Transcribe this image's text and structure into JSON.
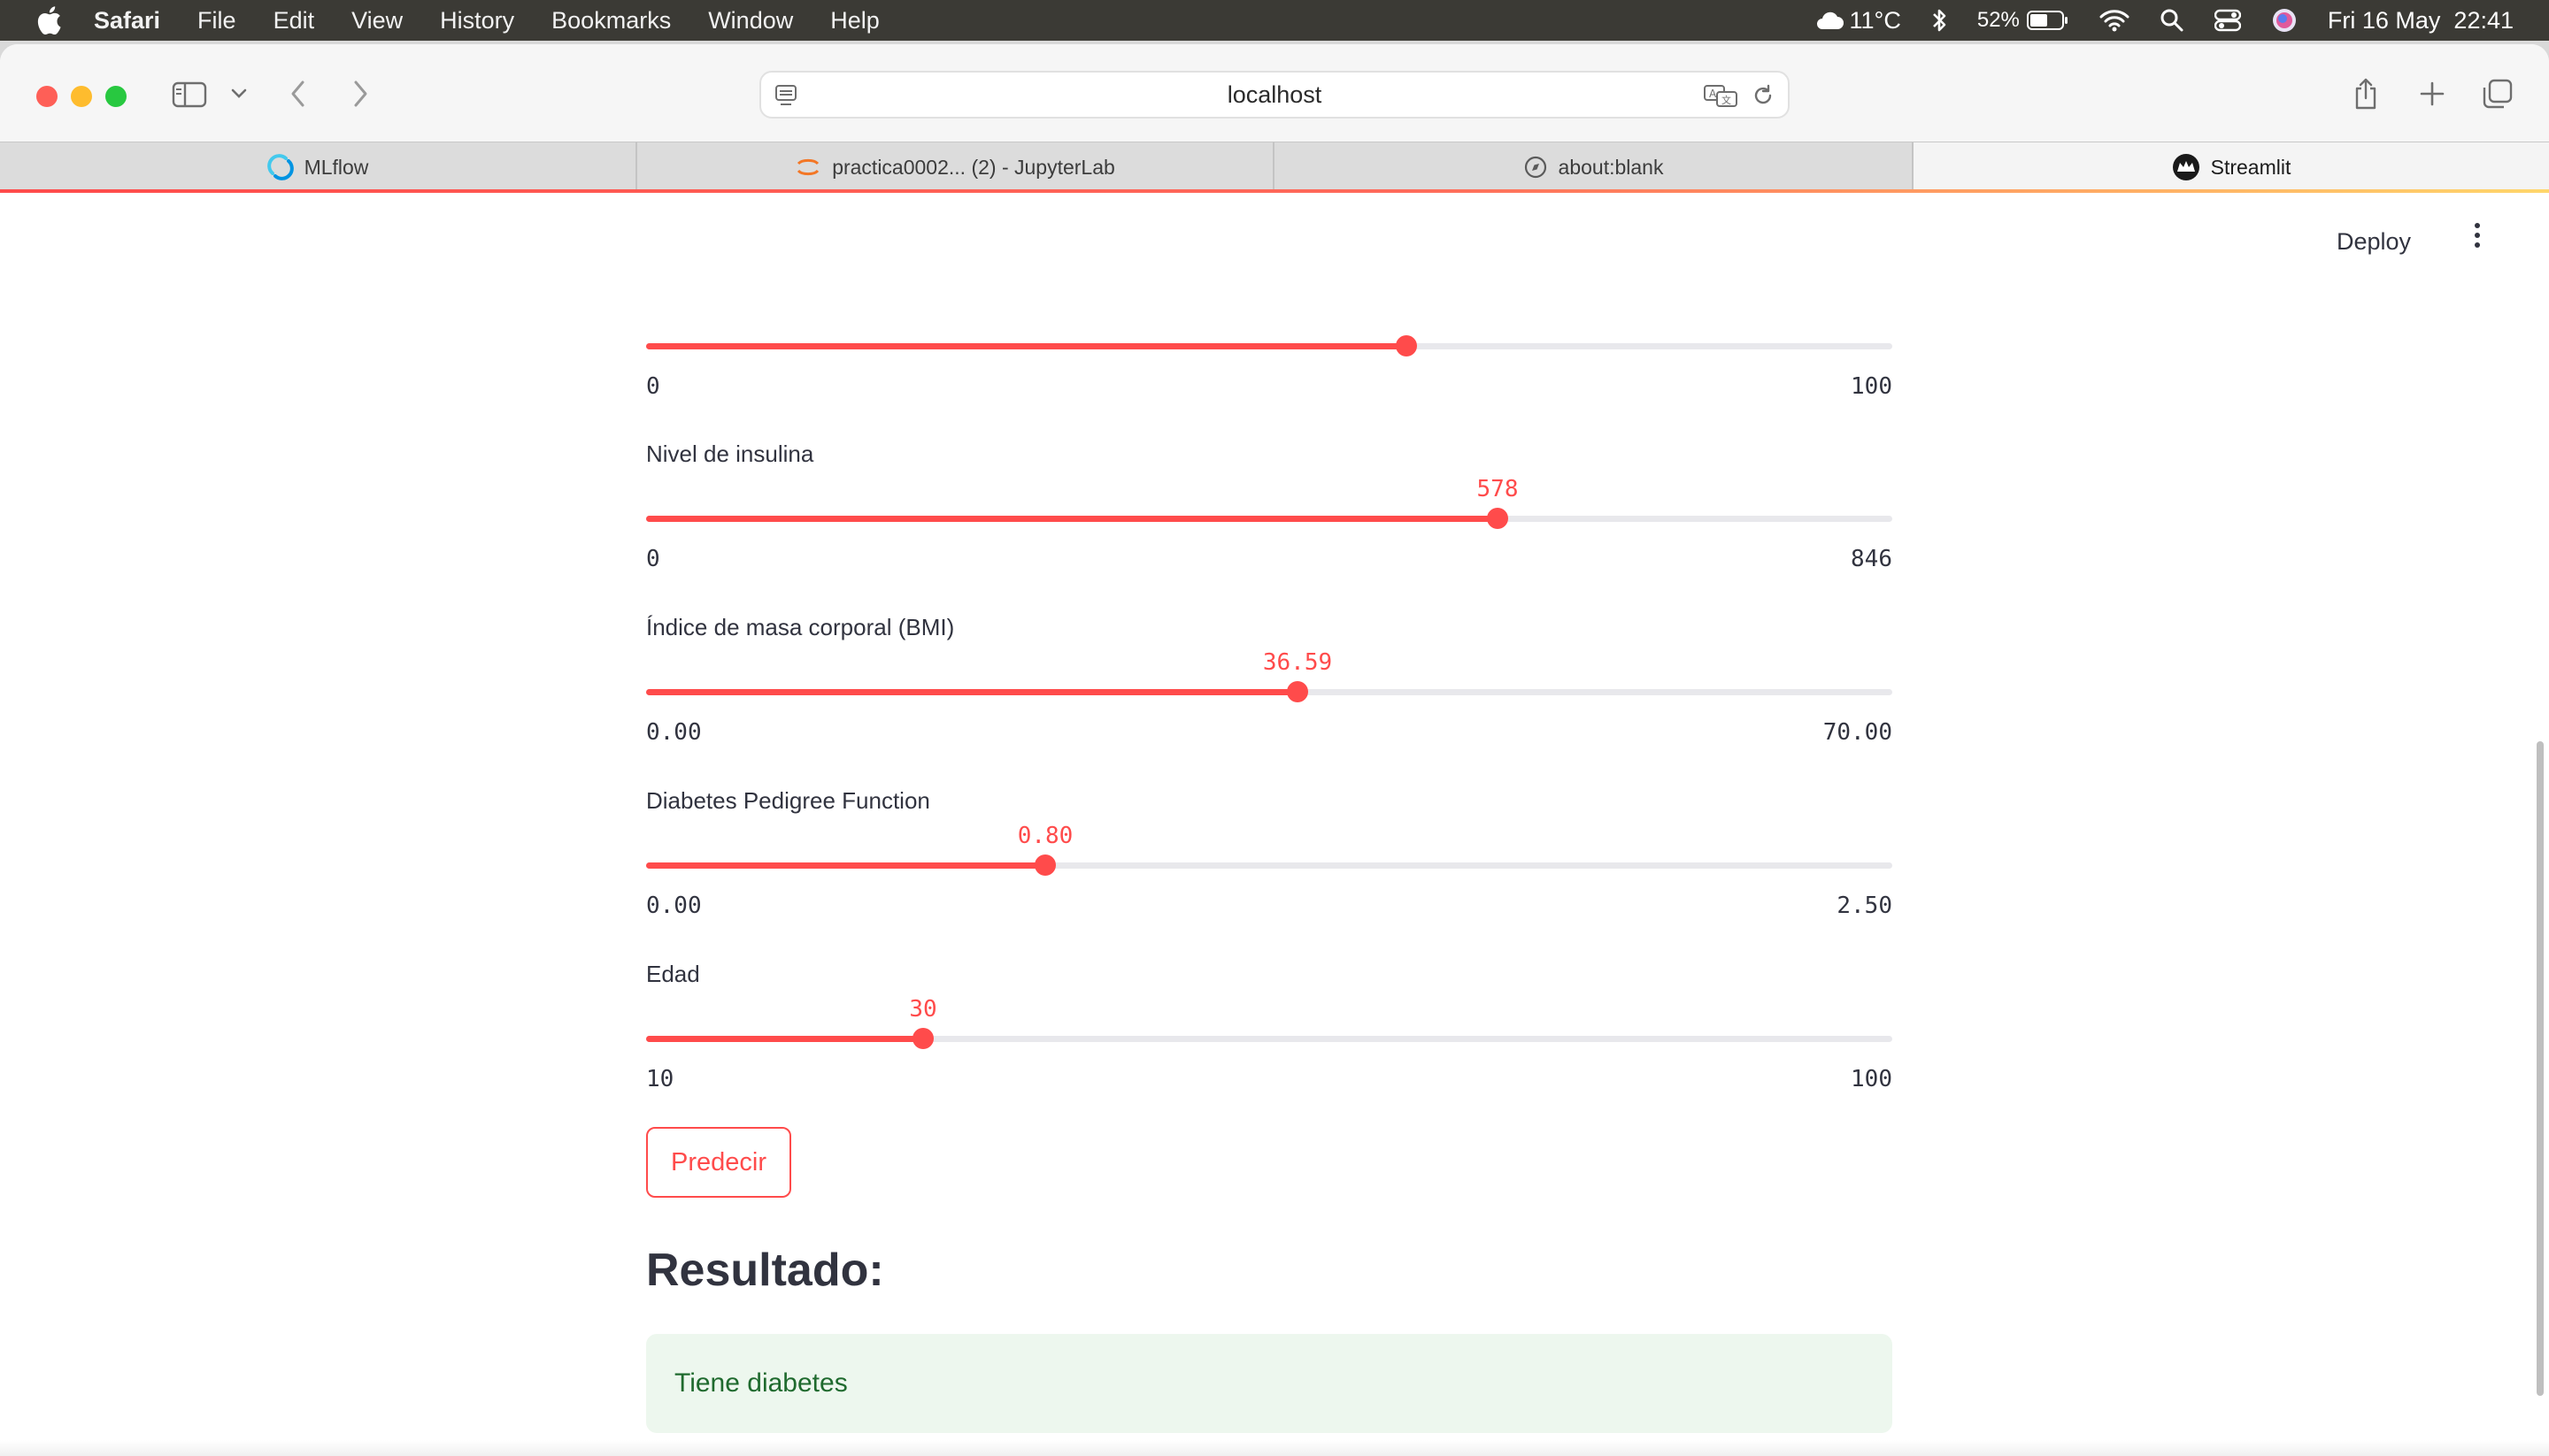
{
  "menubar": {
    "app_name": "Safari",
    "items": [
      "File",
      "Edit",
      "View",
      "History",
      "Bookmarks",
      "Window",
      "Help"
    ],
    "weather": "11°C",
    "battery": "52%",
    "datetime": "Fri 16 May  22:41"
  },
  "browser": {
    "url": "localhost",
    "tabs": [
      {
        "label": "MLflow",
        "icon": "mlflow-icon"
      },
      {
        "label": "practica0002... (2) - JupyterLab",
        "icon": "jupyter-icon"
      },
      {
        "label": "about:blank",
        "icon": "compass-icon"
      },
      {
        "label": "Streamlit",
        "icon": "streamlit-icon",
        "active": true
      }
    ]
  },
  "header": {
    "deploy_label": "Deploy"
  },
  "sliders": [
    {
      "label": "",
      "value": "",
      "min": "0",
      "max": "100",
      "fraction": 0.61
    },
    {
      "label": "Nivel de insulina",
      "value": "578",
      "min": "0",
      "max": "846",
      "fraction": 0.683
    },
    {
      "label": "Índice de masa corporal (BMI)",
      "value": "36.59",
      "min": "0.00",
      "max": "70.00",
      "fraction": 0.523
    },
    {
      "label": "Diabetes Pedigree Function",
      "value": "0.80",
      "min": "0.00",
      "max": "2.50",
      "fraction": 0.32
    },
    {
      "label": "Edad",
      "value": "30",
      "min": "10",
      "max": "100",
      "fraction": 0.222
    }
  ],
  "predict_button": "Predecir",
  "result": {
    "title": "Resultado:",
    "message": "Tiene diabetes"
  },
  "colors": {
    "accent": "#ff4b4b",
    "success_bg": "#edf7ee",
    "success_text": "#1f6a2e"
  }
}
